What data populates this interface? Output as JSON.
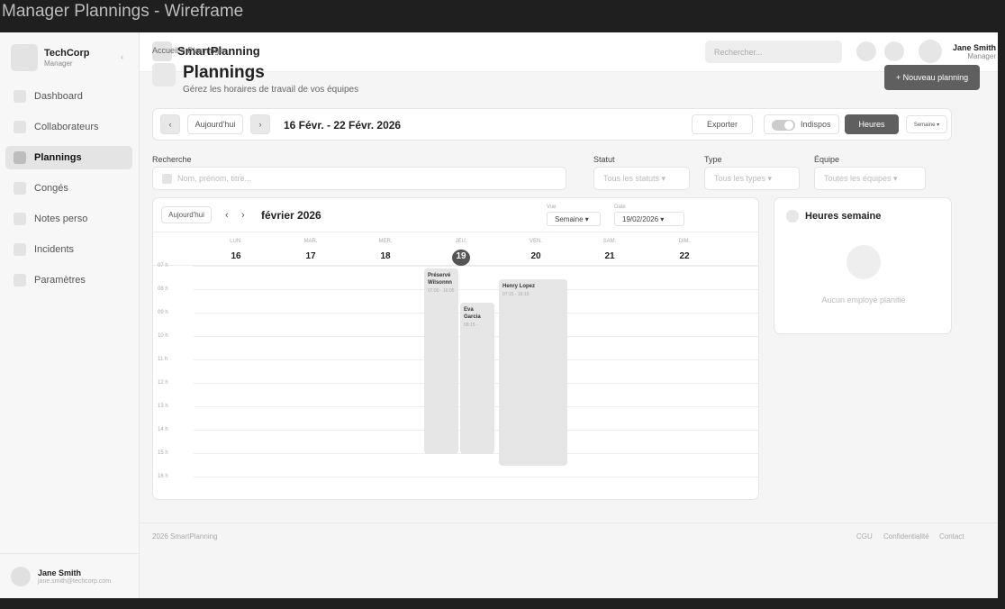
{
  "window": {
    "title": "Manager Plannings - Wireframe"
  },
  "sidebar": {
    "company": "TechCorp",
    "role": "Manager",
    "collapse_icon": "‹",
    "items": [
      {
        "label": "Dashboard"
      },
      {
        "label": "Collaborateurs"
      },
      {
        "label": "Plannings"
      },
      {
        "label": "Congés"
      },
      {
        "label": "Notes perso"
      },
      {
        "label": "Incidents"
      },
      {
        "label": "Paramètres"
      }
    ],
    "user": {
      "name": "Jane Smith",
      "email": "jane.smith@techcorp.com"
    }
  },
  "topbar": {
    "app_name": "SmartPlanning",
    "search_placeholder": "Rechercher...",
    "user": {
      "name": "Jane Smith",
      "role": "Manager"
    }
  },
  "page": {
    "breadcrumb": "Accueil  >  Plannings",
    "title": "Plannings",
    "subtitle": "Gérez les horaires de travail de vos équipes",
    "new_button": "+ Nouveau planning"
  },
  "toolbar": {
    "prev": "‹",
    "today": "Aujourd'hui",
    "next": "›",
    "range": "16 Févr. - 22 Févr. 2026",
    "export": "Exporter",
    "indispos": "Indispos",
    "hours": "Heures",
    "view": "Semaine ▾"
  },
  "filters": {
    "search_label": "Recherche",
    "search_placeholder": "Nom, prénom, titre...",
    "status_label": "Statut",
    "status_value": "Tous les statuts  ▾",
    "type_label": "Type",
    "type_value": "Tous les types  ▾",
    "team_label": "Équipe",
    "team_value": "Toutes les équipes  ▾"
  },
  "calendar": {
    "today": "Aujourd'hui",
    "prev": "‹",
    "next": "›",
    "month": "février 2026",
    "view_label": "Vue",
    "view_value": "Semaine  ▾",
    "date_label": "Date",
    "date_value": "19/02/2026  ▾",
    "days": [
      {
        "name": "LUN.",
        "num": "16"
      },
      {
        "name": "MAR.",
        "num": "17"
      },
      {
        "name": "MER.",
        "num": "18"
      },
      {
        "name": "JEU.",
        "num": "19"
      },
      {
        "name": "VEN.",
        "num": "20"
      },
      {
        "name": "SAM.",
        "num": "21"
      },
      {
        "name": "DIM.",
        "num": "22"
      }
    ],
    "hours": [
      "07 h",
      "08 h",
      "09 h",
      "10 h",
      "11 h",
      "12 h",
      "13 h",
      "14 h",
      "15 h",
      "16 h"
    ],
    "events": [
      {
        "name": "Préservé Wilsonnn",
        "time": "07:00 - 16:00"
      },
      {
        "name": "Eva Garcia",
        "time": "08:15 -"
      },
      {
        "name": "Henry Lopez",
        "time": "07:15 - 16:15"
      }
    ]
  },
  "hours_panel": {
    "title": "Heures semaine",
    "empty": "Aucun employé planifié"
  },
  "footer": {
    "copyright": "2026 SmartPlanning",
    "links": [
      "CGU",
      "Confidentialité",
      "Contact"
    ]
  }
}
